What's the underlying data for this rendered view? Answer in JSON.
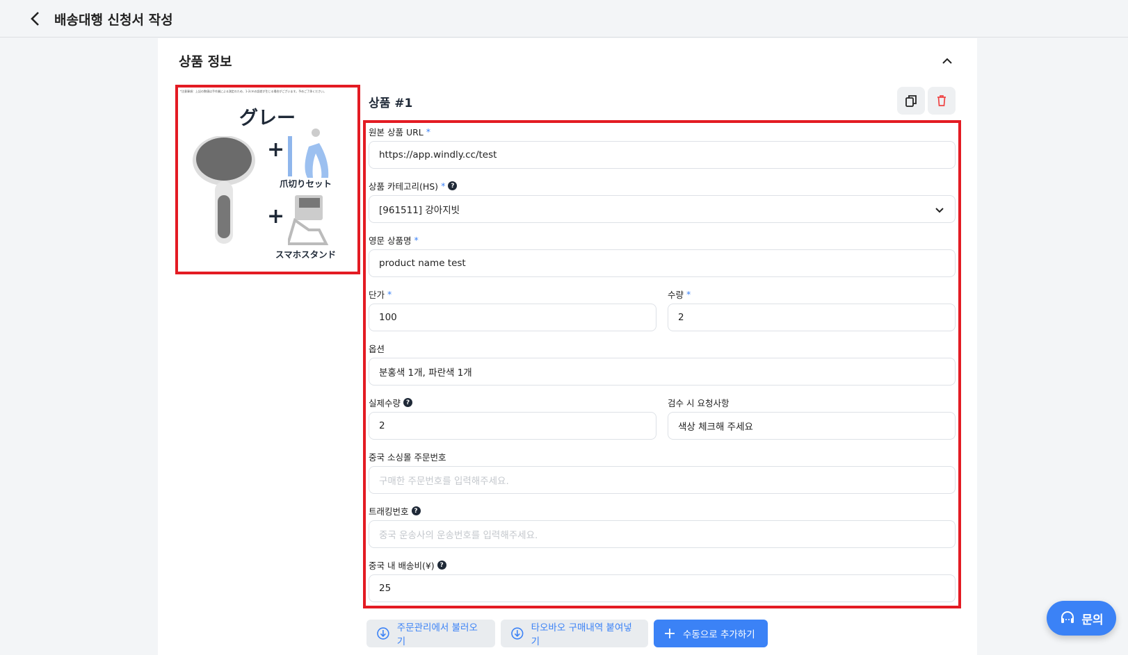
{
  "header": {
    "title": "배송대행 신청서 작성",
    "back_icon": "chevron-left-icon"
  },
  "section": {
    "title": "상품 정보",
    "collapse_icon": "chevron-up-icon"
  },
  "product": {
    "title": "상품 #1",
    "image": {
      "headline": "グレー",
      "label1": "爪切りセット",
      "label2": "スマホスタンド",
      "fine_print": "*注意事項：上記の数値は手作業による測定のため、1-2cmの誤差が生じる場合がございます。予めご了承ください。"
    },
    "copy_icon": "copy-icon",
    "delete_icon": "trash-icon"
  },
  "form": {
    "url": {
      "label": "원본 상품 URL",
      "value": "https://app.windly.cc/test"
    },
    "category": {
      "label": "상품 카테고리(HS)",
      "value": "[961511] 강아지빗"
    },
    "name_en": {
      "label": "영문 상품명",
      "value": "product name test"
    },
    "price": {
      "label": "단가",
      "value": "100"
    },
    "qty": {
      "label": "수량",
      "value": "2"
    },
    "option": {
      "label": "옵션",
      "value": "분홍색 1개, 파란색 1개"
    },
    "actual_qty": {
      "label": "실제수량",
      "value": "2"
    },
    "inspect": {
      "label": "검수 시 요청사항",
      "value": "색상 체크해 주세요"
    },
    "order_no": {
      "label": "중국 소싱몰 주문번호",
      "placeholder": "구매한 주문번호를 입력해주세요."
    },
    "tracking": {
      "label": "트래킹번호",
      "placeholder": "중국 운송사의 운송번호를 입력해주세요."
    },
    "ship_fee": {
      "label": "중국 내 배송비(¥)",
      "value": "25"
    },
    "required_mark": "*",
    "help_mark": "?"
  },
  "actions": {
    "load_orders": "주문관리에서 불러오기",
    "paste_taobao": "타오바오 구매내역 붙여넣기",
    "add_manual": "수동으로 추가하기"
  },
  "fab": {
    "label": "문의",
    "icon": "headset-icon"
  },
  "colors": {
    "accent": "#3b82f6",
    "highlight": "#e31b23"
  }
}
